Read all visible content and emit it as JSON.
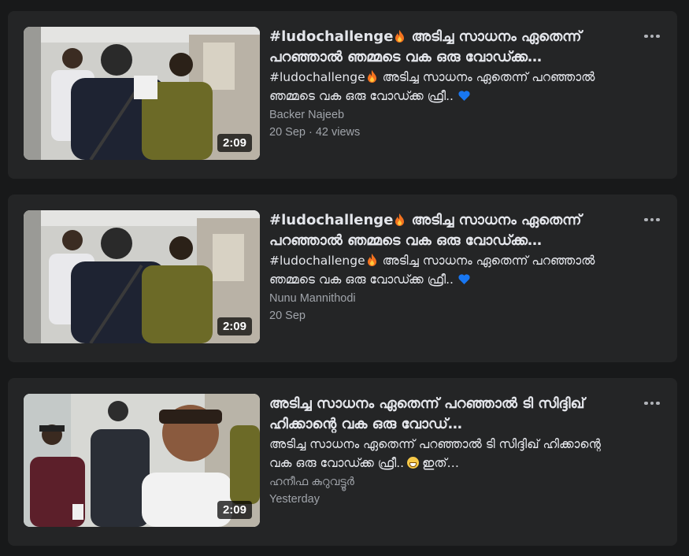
{
  "colors": {
    "background": "#18191a",
    "card": "#242526",
    "text": "#e4e6eb",
    "muted": "#a0a4aa",
    "heart": "#1877f2"
  },
  "icons": {
    "more": "more-options-icon",
    "fire": "fire-emoji-icon",
    "heart": "blue-heart-emoji-icon",
    "grin": "grinning-emoji-icon"
  },
  "videos": [
    {
      "title_tag": "#ludochallenge",
      "title_text": " അടിച്ച സാധനം ഏതെന്ന് പറഞ്ഞാൽ ഞമ്മടെ വക ഒരു വോഡ്ക്ക…",
      "desc_tag": "#ludochallenge",
      "desc_text": " അടിച്ച സാധനം ഏതെന്ന് പറഞ്ഞാൽ ഞമ്മടെ വക ഒരു വോഡ്ക്ക ഫ്രീ..",
      "author": "Backer Najeeb",
      "meta": "20 Sep · 42 views",
      "duration": "2:09"
    },
    {
      "title_tag": "#ludochallenge",
      "title_text": " അടിച്ച സാധനം ഏതെന്ന് പറഞ്ഞാൽ ഞമ്മടെ വക ഒരു വോഡ്ക്ക…",
      "desc_tag": "#ludochallenge",
      "desc_text": " അടിച്ച സാധനം ഏതെന്ന് പറഞ്ഞാൽ ഞമ്മടെ വക ഒരു വോഡ്ക്ക ഫ്രീ..",
      "author": "Nunu Mannithodi",
      "meta": "20 Sep",
      "duration": "2:09"
    },
    {
      "title_text": "അടിച്ച സാധനം ഏതെന്ന് പറഞ്ഞാൽ ടി സിദ്ദിഖ് ഹിക്കാന്റെ വക ഒരു വോഡ്…",
      "desc_text": "അടിച്ച സാധനം ഏതെന്ന് പറഞ്ഞാൽ ടി സിദ്ദിഖ് ഹിക്കാന്റെ വക ഒരു വോഡ്ക്ക ഫ്രീ..",
      "desc_tail": "ഇത്…",
      "author": "ഹനീഫ കുറുവട്ടൂർ",
      "meta": "Yesterday",
      "duration": "2:09"
    }
  ]
}
